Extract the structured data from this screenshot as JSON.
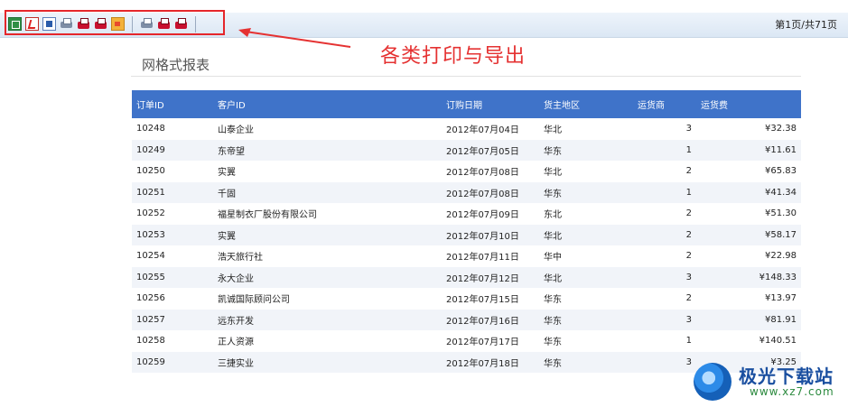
{
  "toolbar": {
    "buttons": [
      "excel-export",
      "pdf-export",
      "word-export",
      "print",
      "print-pdf",
      "print-red",
      "image-export",
      "print-2",
      "print-pdf-2",
      "print-red-2"
    ],
    "page_info": "第1页/共71页"
  },
  "annotation": {
    "callout": "各类打印与导出",
    "color": "#e53232"
  },
  "report": {
    "title": "网格式报表",
    "columns": [
      "订单ID",
      "客户ID",
      "订购日期",
      "货主地区",
      "运货商",
      "运货费"
    ],
    "rows": [
      [
        "10248",
        "山泰企业",
        "2012年07月04日",
        "华北",
        "3",
        "¥32.38"
      ],
      [
        "10249",
        "东帝望",
        "2012年07月05日",
        "华东",
        "1",
        "¥11.61"
      ],
      [
        "10250",
        "实翼",
        "2012年07月08日",
        "华北",
        "2",
        "¥65.83"
      ],
      [
        "10251",
        "千固",
        "2012年07月08日",
        "华东",
        "1",
        "¥41.34"
      ],
      [
        "10252",
        "福星制衣厂股份有限公司",
        "2012年07月09日",
        "东北",
        "2",
        "¥51.30"
      ],
      [
        "10253",
        "实翼",
        "2012年07月10日",
        "华北",
        "2",
        "¥58.17"
      ],
      [
        "10254",
        "浩天旅行社",
        "2012年07月11日",
        "华中",
        "2",
        "¥22.98"
      ],
      [
        "10255",
        "永大企业",
        "2012年07月12日",
        "华北",
        "3",
        "¥148.33"
      ],
      [
        "10256",
        "凯诚国际顾问公司",
        "2012年07月15日",
        "华东",
        "2",
        "¥13.97"
      ],
      [
        "10257",
        "远东开发",
        "2012年07月16日",
        "华东",
        "3",
        "¥81.91"
      ],
      [
        "10258",
        "正人资源",
        "2012年07月17日",
        "华东",
        "1",
        "¥140.51"
      ],
      [
        "10259",
        "三捷实业",
        "2012年07月18日",
        "华东",
        "3",
        "¥3.25"
      ]
    ],
    "header_color": "#3f73c9"
  },
  "watermark": {
    "name": "极光下载站",
    "url": "www.xz7.com"
  }
}
